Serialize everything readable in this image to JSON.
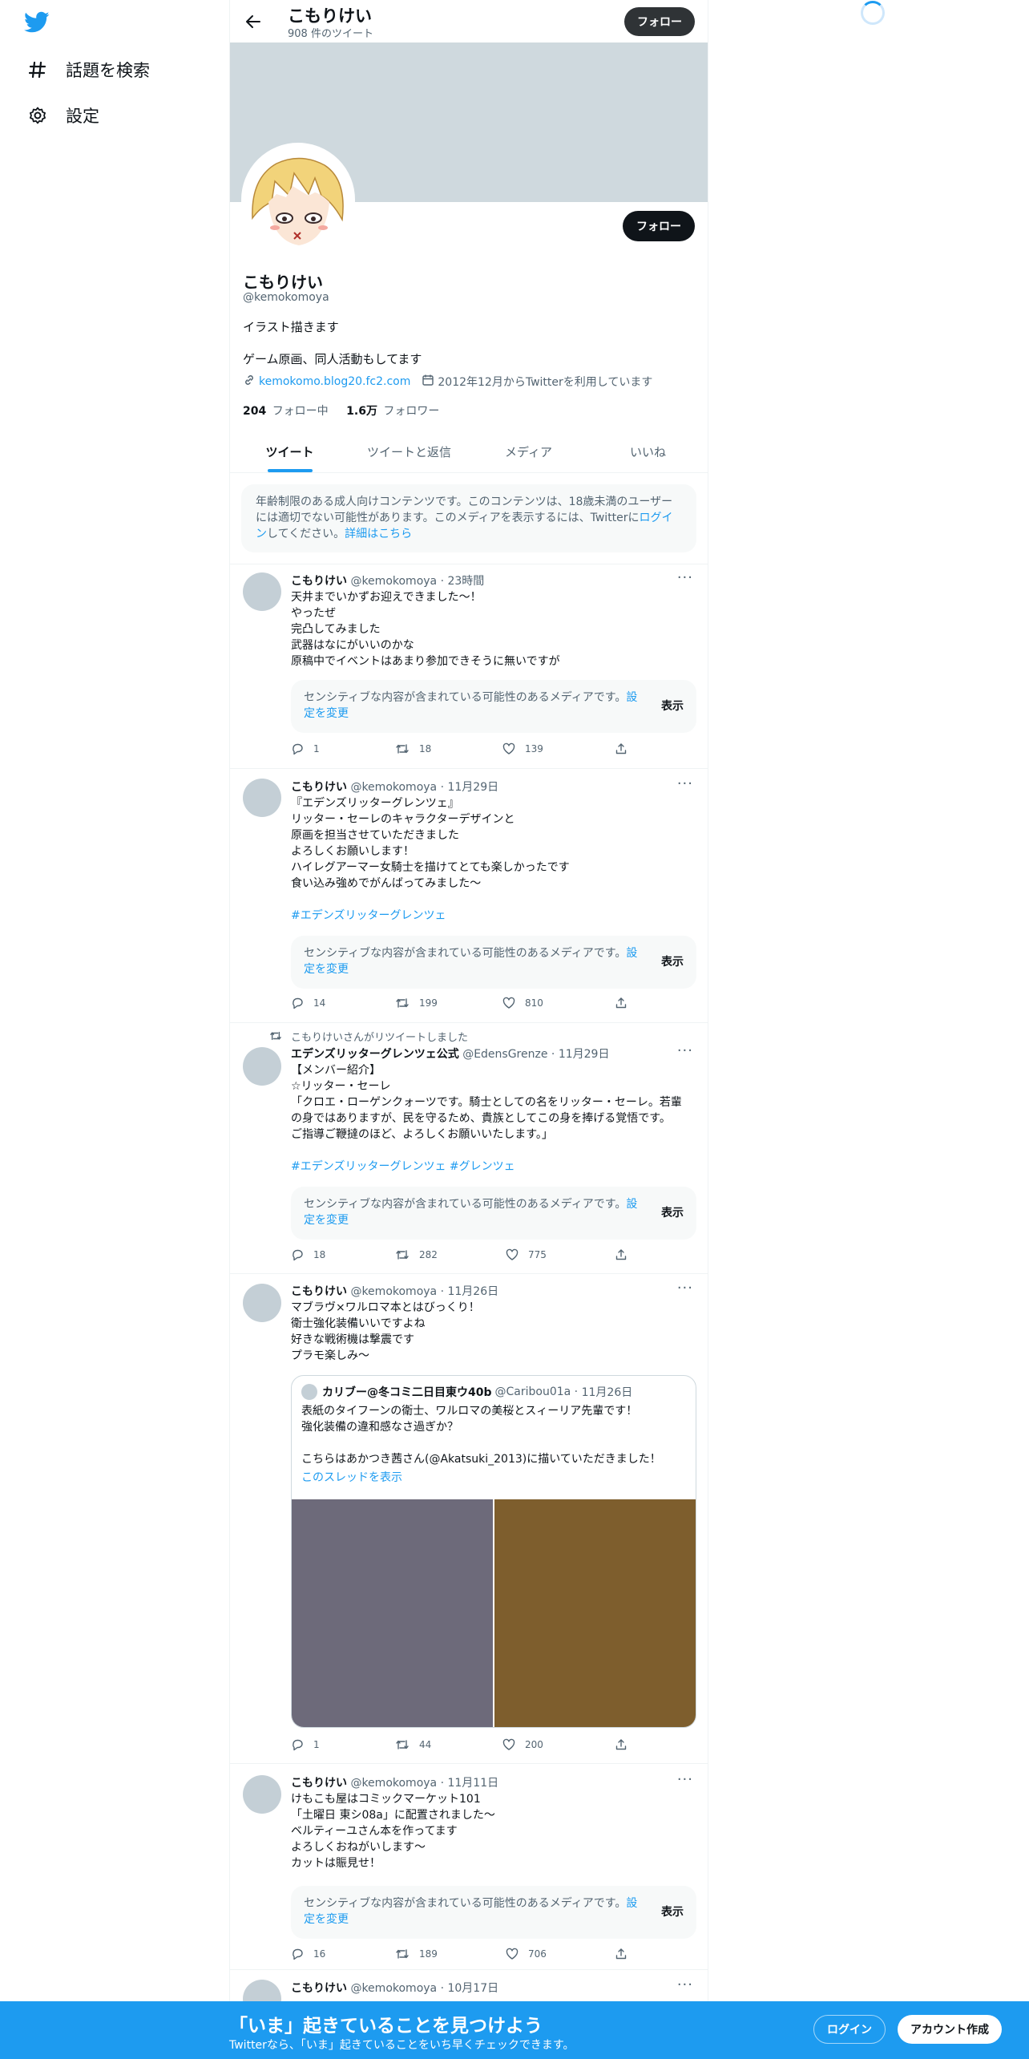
{
  "nav": {
    "logo_icon": "twitter-bird-icon",
    "items": [
      {
        "icon": "hashtag-icon",
        "label": "話題を検索"
      },
      {
        "icon": "gear-icon",
        "label": "設定"
      }
    ]
  },
  "header": {
    "name": "こもりけい",
    "tweet_count": "908 件のツイート",
    "follow_label": "フォロー"
  },
  "profile": {
    "name": "こもりけい",
    "handle": "@kemokomoya",
    "bio_line1": "イラスト描きます",
    "bio_line2": "ゲーム原画、同人活動もしてます",
    "website": "kemokomo.blog20.fc2.com",
    "joined": "2012年12月からTwitterを利用しています",
    "following_count": "204",
    "following_label": "フォロー中",
    "followers_count": "1.6万",
    "followers_label": "フォロワー",
    "follow_label": "フォロー"
  },
  "tabs": [
    {
      "label": "ツイート",
      "active": true
    },
    {
      "label": "ツイートと返信",
      "active": false
    },
    {
      "label": "メディア",
      "active": false
    },
    {
      "label": "いいね",
      "active": false
    }
  ],
  "notice": {
    "text_a": "年齢制限のある成人向けコンテンツです。このコンテンツは、18歳未満のユーザーには適切でない可能性があります。このメディアを表示するには、Twitterに",
    "login_link": "ログイン",
    "text_b": "してください。",
    "details_link": "詳細はこちら"
  },
  "sensitive": {
    "text": "センシティブな内容が含まれている可能性のあるメディアです。",
    "settings_link": "設定を変更",
    "show_label": "表示"
  },
  "tweets": [
    {
      "name": "こもりけい",
      "handle": "@kemokomoya",
      "time": "23時間",
      "text": "天井までいかずお迎えできました～！\nやったぜ\n完凸してみました\n武器はなにがいいのかな\n原稿中でイベントはあまり参加できそうに無いですが",
      "replies": "1",
      "retweets": "18",
      "likes": "139"
    },
    {
      "name": "こもりけい",
      "handle": "@kemokomoya",
      "time": "11月29日",
      "text": "『エデンズリッターグレンツェ』\nリッター・セーレのキャラクターデザインと\n原画を担当させていただきました\nよろしくお願いします！\nハイレグアーマー女騎士を描けてとても楽しかったです\n食い込み強めでがんばってみました～",
      "hashtag": "#エデンズリッターグレンツェ",
      "replies": "14",
      "retweets": "199",
      "likes": "810"
    },
    {
      "retweet_note": "こもりけいさんがリツイートしました",
      "name": "エデンズリッターグレンツェ公式",
      "handle": "@EdensGrenze",
      "time": "11月29日",
      "text": "【メンバー紹介】\n☆リッター・セーレ\n「クロエ・ローゲンクォーツです。騎士としての名をリッター・セーレ。若輩の身ではありますが、民を守るため、貴族としてこの身を捧げる覚悟です。\nご指導ご鞭撻のほど、よろしくお願いいたします。」",
      "hashtags": "#エデンズリッターグレンツェ #グレンツェ",
      "replies": "18",
      "retweets": "282",
      "likes": "775"
    },
    {
      "name": "こもりけい",
      "handle": "@kemokomoya",
      "time": "11月26日",
      "text": "マブラヴ×ワルロマ本とはびっくり！\n衛士強化装備いいですよね\n好きな戦術機は撃震です\nプラモ楽しみ～",
      "quote": {
        "name": "カリブー@冬コミ二日目東ウ40b",
        "handle": "@Caribou01a",
        "time": "11月26日",
        "text": "表紙のタイフーンの衛士、ワルロマの美桜とスィーリア先輩です！\n強化装備の違和感なさ過ぎか？\n\nこちらはあかつき茜さん(@Akatsuki_2013)に描いていただきました！",
        "thread_link": "このスレッドを表示"
      },
      "replies": "1",
      "retweets": "44",
      "likes": "200"
    },
    {
      "name": "こもりけい",
      "handle": "@kemokomoya",
      "time": "11月11日",
      "text": "けもこも屋はコミックマーケット101\n「土曜日 東シ08a」に配置されました～\nベルティーユさん本を作ってます\nよろしくおねがいします～\nカットは賑見せ！",
      "replies": "16",
      "retweets": "189",
      "likes": "706"
    },
    {
      "name": "こもりけい",
      "handle": "@kemokomoya",
      "time": "10月17日"
    }
  ],
  "bottom_bar": {
    "title": "「いま」起きていることを見つけよう",
    "subtitle": "Twitterなら、「いま」起きていることをいち早くチェックできます。",
    "login_label": "ログイン",
    "signup_label": "アカウント作成"
  },
  "colors": {
    "accent": "#1d9bf0",
    "banner": "#cfd9de",
    "bottom_bar": "#1d9bf0"
  }
}
